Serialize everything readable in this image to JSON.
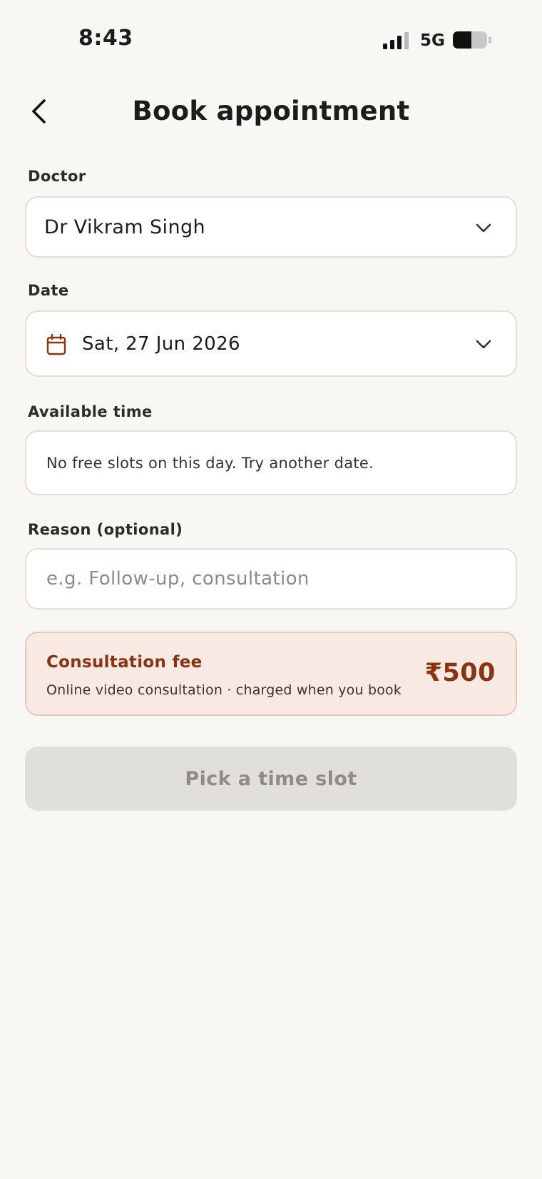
{
  "status_bar": {
    "time": "8:43",
    "network": "5G"
  },
  "header": {
    "title": "Book appointment"
  },
  "form": {
    "doctor": {
      "label": "Doctor",
      "value": "Dr Vikram Singh"
    },
    "date": {
      "label": "Date",
      "value": "Sat, 27 Jun 2026"
    },
    "available_time": {
      "label": "Available time",
      "message": "No free slots on this day. Try another date."
    },
    "reason": {
      "label": "Reason (optional)",
      "value": "",
      "placeholder": "e.g. Follow-up, consultation"
    }
  },
  "fee": {
    "title": "Consultation fee",
    "subtitle": "Online video consultation · charged when you book",
    "amount": "₹500"
  },
  "primary_button": {
    "label": "Pick a time slot",
    "disabled": true
  },
  "colors": {
    "background": "#f8f7f4",
    "accent": "#8a3510",
    "fee_card_bg": "#f8e9e2",
    "button_disabled_bg": "#e1dfdb",
    "button_disabled_text": "#8f8c88"
  }
}
